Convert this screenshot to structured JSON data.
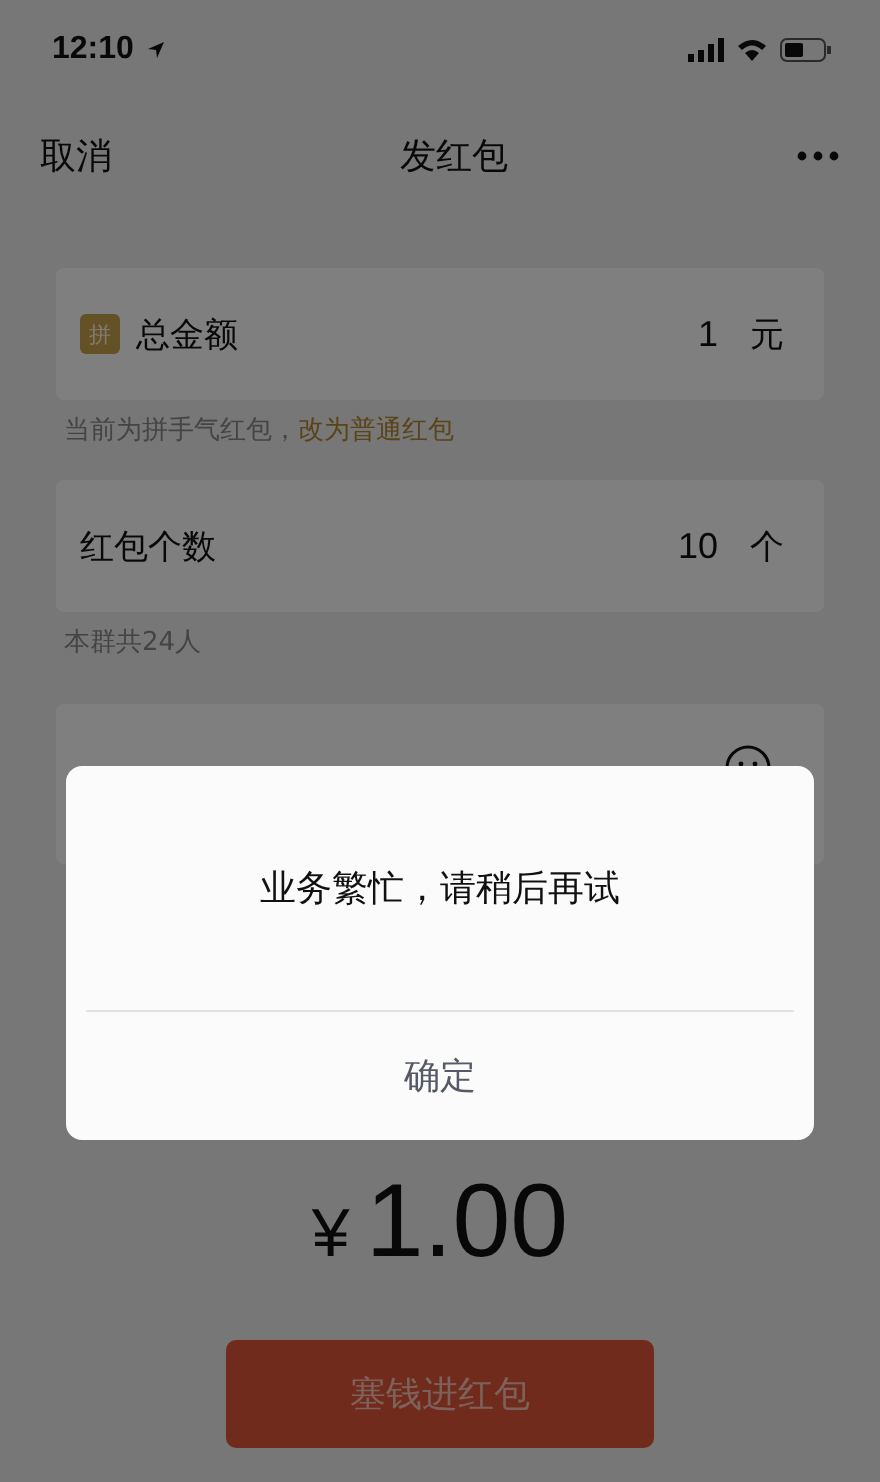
{
  "status_bar": {
    "time": "12:10"
  },
  "nav": {
    "cancel": "取消",
    "title": "发红包"
  },
  "amount_row": {
    "badge": "拼",
    "label": "总金额",
    "value": "1",
    "unit": "元"
  },
  "amount_hint": {
    "text": "当前为拼手气红包，",
    "link": "改为普通红包"
  },
  "count_row": {
    "label": "红包个数",
    "value": "10",
    "unit": "个"
  },
  "count_hint": "本群共24人",
  "total": {
    "currency": "¥",
    "amount": "1.00"
  },
  "submit_button": "塞钱进红包",
  "dialog": {
    "message": "业务繁忙，请稍后再试",
    "buttons": [
      "确定"
    ]
  }
}
